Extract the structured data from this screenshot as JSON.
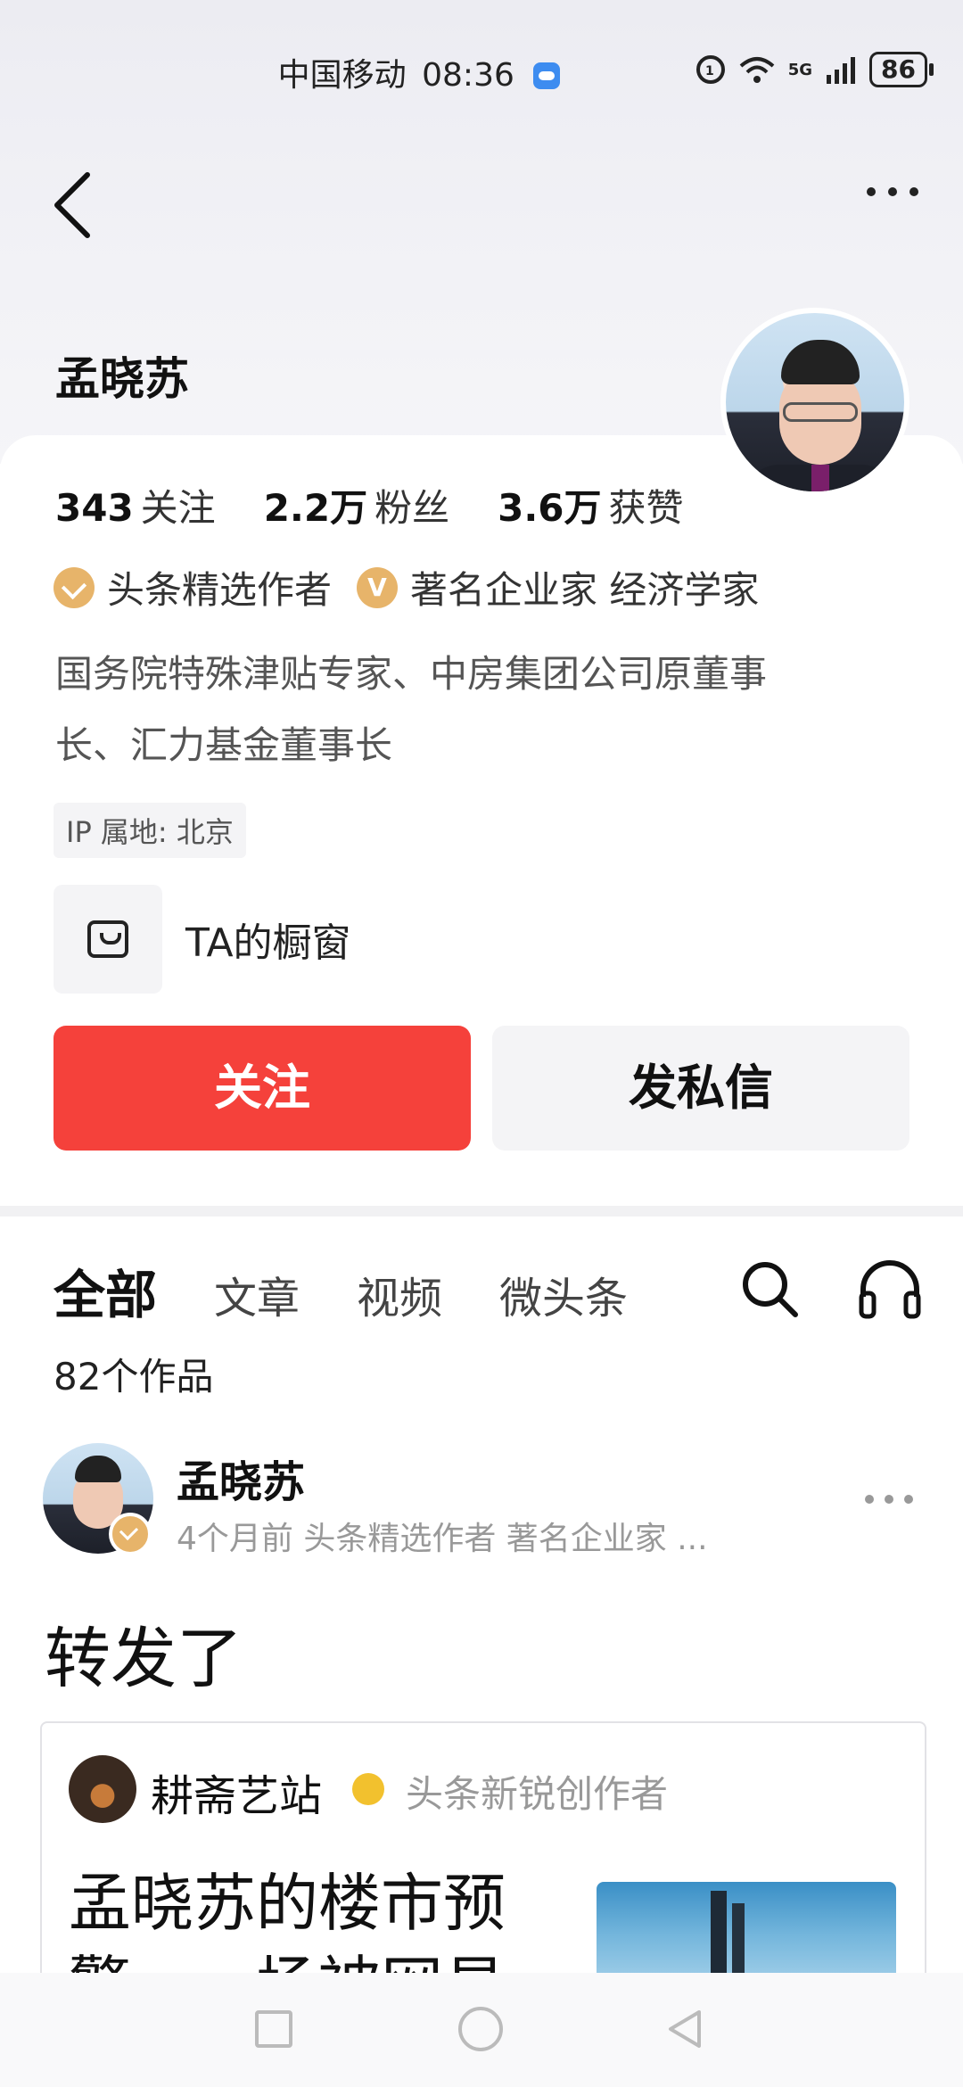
{
  "status_bar": {
    "carrier": "中国移动",
    "time": "08:36",
    "network": "5G",
    "battery": "86"
  },
  "profile": {
    "name": "孟晓苏",
    "stats": [
      {
        "value": "343",
        "label": "关注"
      },
      {
        "value": "2.2万",
        "label": "粉丝"
      },
      {
        "value": "3.6万",
        "label": "获赞"
      }
    ],
    "badges": {
      "author": "头条精选作者",
      "title": "著名企业家 经济学家",
      "v": "V"
    },
    "bio_line1": "国务院特殊津贴专家、中房集团公司原董事",
    "bio_line2": "长、汇力基金董事长",
    "ip": "IP 属地: 北京",
    "shop_label": "TA的橱窗",
    "follow_label": "关注",
    "message_label": "发私信"
  },
  "tabs": [
    {
      "label": "全部",
      "active": true
    },
    {
      "label": "文章"
    },
    {
      "label": "视频"
    },
    {
      "label": "微头条"
    }
  ],
  "works_count": "82个作品",
  "post": {
    "author": "孟晓苏",
    "meta": "4个月前  头条精选作者 著名企业家 ...",
    "text": "转发了",
    "quote": {
      "author": "耕斋艺站",
      "author_desc": "头条新锐创作者",
      "title": "孟晓苏的楼市预警……场被网易"
    }
  }
}
